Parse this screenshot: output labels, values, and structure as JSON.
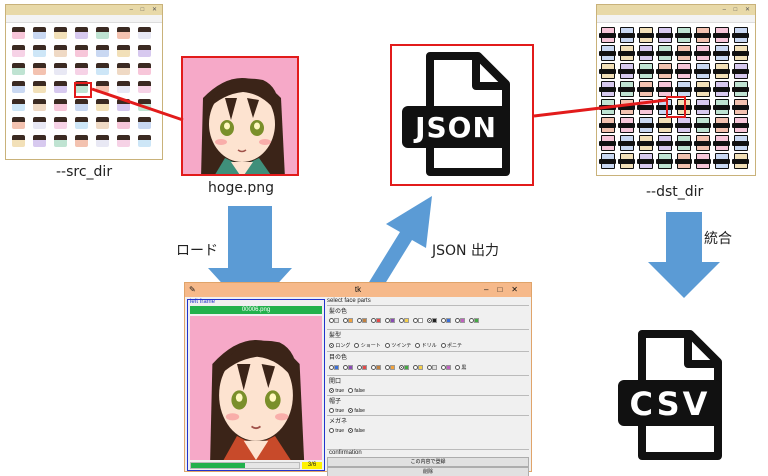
{
  "captions": {
    "src_dir": "--src_dir",
    "dst_dir": "--dst_dir",
    "hoge": "hoge.png",
    "load": "ロード",
    "json_out": "JSON 出力",
    "merge": "統合"
  },
  "icons": {
    "json": "JSON",
    "csv": "CSV"
  },
  "tk_window": {
    "title": "tk",
    "left_frame": "left frame",
    "file_name": "00006.png",
    "counter": "3/6",
    "progress": 0.5,
    "select_face": "select face parts",
    "hair_color_label": "髪の色",
    "hair_style_label": "髪型",
    "hair_style_options": [
      "ロング",
      "ショート",
      "ツインテ",
      "ドリル",
      "ポニテ"
    ],
    "eye_color_label": "目の色",
    "eye_color_extra": "黒",
    "open_mouth_label": "開口",
    "hat_label": "帽子",
    "glasses_label": "メガネ",
    "true_label": "true",
    "false_label": "false",
    "confirmation": "confirmation",
    "register_button": "この内容で登録",
    "delete_button": "削除"
  },
  "colors": {
    "highlight_red": "#e21b1b",
    "arrow_blue": "#5b9bd5",
    "progress_green": "#22b14c",
    "photo_bg": "#f7a6c6"
  }
}
